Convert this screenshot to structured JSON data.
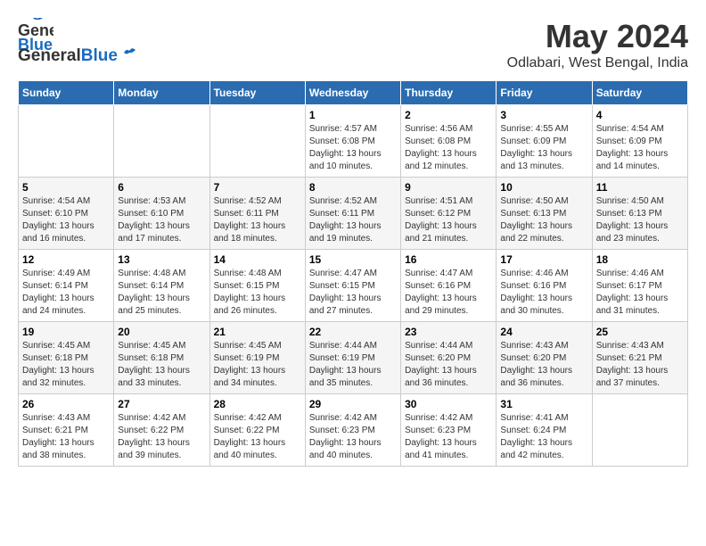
{
  "logo": {
    "general": "General",
    "blue": "Blue"
  },
  "title": "May 2024",
  "location": "Odlabari, West Bengal, India",
  "days_header": [
    "Sunday",
    "Monday",
    "Tuesday",
    "Wednesday",
    "Thursday",
    "Friday",
    "Saturday"
  ],
  "weeks": [
    [
      {
        "day": "",
        "sunrise": "",
        "sunset": "",
        "daylight": ""
      },
      {
        "day": "",
        "sunrise": "",
        "sunset": "",
        "daylight": ""
      },
      {
        "day": "",
        "sunrise": "",
        "sunset": "",
        "daylight": ""
      },
      {
        "day": "1",
        "sunrise": "Sunrise: 4:57 AM",
        "sunset": "Sunset: 6:08 PM",
        "daylight": "Daylight: 13 hours and 10 minutes."
      },
      {
        "day": "2",
        "sunrise": "Sunrise: 4:56 AM",
        "sunset": "Sunset: 6:08 PM",
        "daylight": "Daylight: 13 hours and 12 minutes."
      },
      {
        "day": "3",
        "sunrise": "Sunrise: 4:55 AM",
        "sunset": "Sunset: 6:09 PM",
        "daylight": "Daylight: 13 hours and 13 minutes."
      },
      {
        "day": "4",
        "sunrise": "Sunrise: 4:54 AM",
        "sunset": "Sunset: 6:09 PM",
        "daylight": "Daylight: 13 hours and 14 minutes."
      }
    ],
    [
      {
        "day": "5",
        "sunrise": "Sunrise: 4:54 AM",
        "sunset": "Sunset: 6:10 PM",
        "daylight": "Daylight: 13 hours and 16 minutes."
      },
      {
        "day": "6",
        "sunrise": "Sunrise: 4:53 AM",
        "sunset": "Sunset: 6:10 PM",
        "daylight": "Daylight: 13 hours and 17 minutes."
      },
      {
        "day": "7",
        "sunrise": "Sunrise: 4:52 AM",
        "sunset": "Sunset: 6:11 PM",
        "daylight": "Daylight: 13 hours and 18 minutes."
      },
      {
        "day": "8",
        "sunrise": "Sunrise: 4:52 AM",
        "sunset": "Sunset: 6:11 PM",
        "daylight": "Daylight: 13 hours and 19 minutes."
      },
      {
        "day": "9",
        "sunrise": "Sunrise: 4:51 AM",
        "sunset": "Sunset: 6:12 PM",
        "daylight": "Daylight: 13 hours and 21 minutes."
      },
      {
        "day": "10",
        "sunrise": "Sunrise: 4:50 AM",
        "sunset": "Sunset: 6:13 PM",
        "daylight": "Daylight: 13 hours and 22 minutes."
      },
      {
        "day": "11",
        "sunrise": "Sunrise: 4:50 AM",
        "sunset": "Sunset: 6:13 PM",
        "daylight": "Daylight: 13 hours and 23 minutes."
      }
    ],
    [
      {
        "day": "12",
        "sunrise": "Sunrise: 4:49 AM",
        "sunset": "Sunset: 6:14 PM",
        "daylight": "Daylight: 13 hours and 24 minutes."
      },
      {
        "day": "13",
        "sunrise": "Sunrise: 4:48 AM",
        "sunset": "Sunset: 6:14 PM",
        "daylight": "Daylight: 13 hours and 25 minutes."
      },
      {
        "day": "14",
        "sunrise": "Sunrise: 4:48 AM",
        "sunset": "Sunset: 6:15 PM",
        "daylight": "Daylight: 13 hours and 26 minutes."
      },
      {
        "day": "15",
        "sunrise": "Sunrise: 4:47 AM",
        "sunset": "Sunset: 6:15 PM",
        "daylight": "Daylight: 13 hours and 27 minutes."
      },
      {
        "day": "16",
        "sunrise": "Sunrise: 4:47 AM",
        "sunset": "Sunset: 6:16 PM",
        "daylight": "Daylight: 13 hours and 29 minutes."
      },
      {
        "day": "17",
        "sunrise": "Sunrise: 4:46 AM",
        "sunset": "Sunset: 6:16 PM",
        "daylight": "Daylight: 13 hours and 30 minutes."
      },
      {
        "day": "18",
        "sunrise": "Sunrise: 4:46 AM",
        "sunset": "Sunset: 6:17 PM",
        "daylight": "Daylight: 13 hours and 31 minutes."
      }
    ],
    [
      {
        "day": "19",
        "sunrise": "Sunrise: 4:45 AM",
        "sunset": "Sunset: 6:18 PM",
        "daylight": "Daylight: 13 hours and 32 minutes."
      },
      {
        "day": "20",
        "sunrise": "Sunrise: 4:45 AM",
        "sunset": "Sunset: 6:18 PM",
        "daylight": "Daylight: 13 hours and 33 minutes."
      },
      {
        "day": "21",
        "sunrise": "Sunrise: 4:45 AM",
        "sunset": "Sunset: 6:19 PM",
        "daylight": "Daylight: 13 hours and 34 minutes."
      },
      {
        "day": "22",
        "sunrise": "Sunrise: 4:44 AM",
        "sunset": "Sunset: 6:19 PM",
        "daylight": "Daylight: 13 hours and 35 minutes."
      },
      {
        "day": "23",
        "sunrise": "Sunrise: 4:44 AM",
        "sunset": "Sunset: 6:20 PM",
        "daylight": "Daylight: 13 hours and 36 minutes."
      },
      {
        "day": "24",
        "sunrise": "Sunrise: 4:43 AM",
        "sunset": "Sunset: 6:20 PM",
        "daylight": "Daylight: 13 hours and 36 minutes."
      },
      {
        "day": "25",
        "sunrise": "Sunrise: 4:43 AM",
        "sunset": "Sunset: 6:21 PM",
        "daylight": "Daylight: 13 hours and 37 minutes."
      }
    ],
    [
      {
        "day": "26",
        "sunrise": "Sunrise: 4:43 AM",
        "sunset": "Sunset: 6:21 PM",
        "daylight": "Daylight: 13 hours and 38 minutes."
      },
      {
        "day": "27",
        "sunrise": "Sunrise: 4:42 AM",
        "sunset": "Sunset: 6:22 PM",
        "daylight": "Daylight: 13 hours and 39 minutes."
      },
      {
        "day": "28",
        "sunrise": "Sunrise: 4:42 AM",
        "sunset": "Sunset: 6:22 PM",
        "daylight": "Daylight: 13 hours and 40 minutes."
      },
      {
        "day": "29",
        "sunrise": "Sunrise: 4:42 AM",
        "sunset": "Sunset: 6:23 PM",
        "daylight": "Daylight: 13 hours and 40 minutes."
      },
      {
        "day": "30",
        "sunrise": "Sunrise: 4:42 AM",
        "sunset": "Sunset: 6:23 PM",
        "daylight": "Daylight: 13 hours and 41 minutes."
      },
      {
        "day": "31",
        "sunrise": "Sunrise: 4:41 AM",
        "sunset": "Sunset: 6:24 PM",
        "daylight": "Daylight: 13 hours and 42 minutes."
      },
      {
        "day": "",
        "sunrise": "",
        "sunset": "",
        "daylight": ""
      }
    ]
  ]
}
